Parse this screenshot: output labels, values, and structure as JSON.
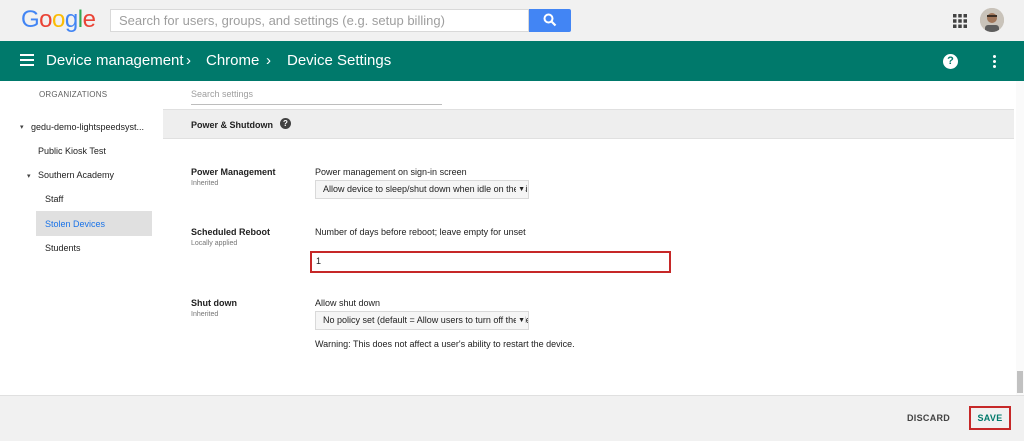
{
  "topbar": {
    "logo_letters": [
      {
        "char": "G",
        "color": "#4285f4"
      },
      {
        "char": "o",
        "color": "#ea4335"
      },
      {
        "char": "o",
        "color": "#fbbc05"
      },
      {
        "char": "g",
        "color": "#4285f4"
      },
      {
        "char": "l",
        "color": "#34a853"
      },
      {
        "char": "e",
        "color": "#ea4335"
      }
    ],
    "search_placeholder": "Search for users, groups, and settings (e.g. setup billing)",
    "search_icon": "search-icon",
    "apps_icon": "apps-grid-icon",
    "avatar_icon": "user-avatar"
  },
  "appbar": {
    "menu_icon": "hamburger-menu-icon",
    "breadcrumbs": [
      "Device management",
      "Chrome",
      "Device Settings"
    ],
    "separator": "›",
    "help_label": "?",
    "more_icon": "more-vert-icon",
    "color": "#00796b"
  },
  "sidebar": {
    "title": "ORGANIZATIONS",
    "items": [
      {
        "label": "gedu-demo-lightspeedsyst...",
        "expanded": true
      },
      {
        "label": "Public Kiosk Test"
      },
      {
        "label": "Southern Academy",
        "expanded": true
      },
      {
        "label": "Staff"
      },
      {
        "label": "Stolen Devices",
        "selected": true
      },
      {
        "label": "Students"
      }
    ],
    "expand_glyph": "▾"
  },
  "main": {
    "search_placeholder": "Search settings",
    "section": {
      "title": "Power & Shutdown",
      "help_label": "?"
    },
    "settings": [
      {
        "name": "Power Management",
        "status": "Inherited",
        "label": "Power management on sign-in screen",
        "select_value": "Allow device to sleep/shut down when idle on the sign-in screen"
      },
      {
        "name": "Scheduled Reboot",
        "status": "Locally applied",
        "label": "Number of days before reboot; leave empty for unset",
        "input_value": "1"
      },
      {
        "name": "Shut down",
        "status": "Inherited",
        "label": "Allow shut down",
        "select_value": "No policy set (default = Allow users to turn off the device)",
        "warning": "Warning: This does not affect a user's ability to restart the device."
      }
    ],
    "dropdown_glyph": "▼"
  },
  "footer": {
    "discard_label": "DISCARD",
    "save_label": "SAVE"
  }
}
